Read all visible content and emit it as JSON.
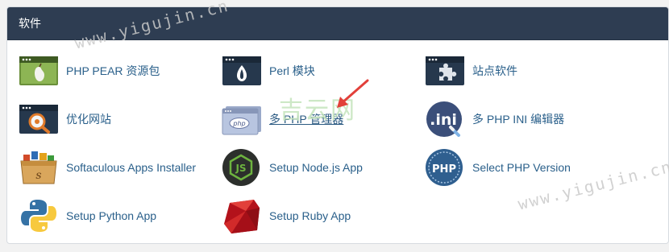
{
  "section": {
    "title": "软件"
  },
  "items": [
    {
      "label": "PHP PEAR 资源包",
      "icon": "pear-icon"
    },
    {
      "label": "Perl 模块",
      "icon": "perl-icon"
    },
    {
      "label": "站点软件",
      "icon": "puzzle-icon"
    },
    {
      "label": "优化网站",
      "icon": "optimize-icon"
    },
    {
      "label": "多 PHP 管理器",
      "icon": "php-manager-icon"
    },
    {
      "label": "多 PHP INI 编辑器",
      "icon": "ini-editor-icon"
    },
    {
      "label": "Softaculous Apps Installer",
      "icon": "softaculous-icon"
    },
    {
      "label": "Setup Node.js App",
      "icon": "nodejs-icon"
    },
    {
      "label": "Select PHP Version",
      "icon": "php-version-icon"
    },
    {
      "label": "Setup Python App",
      "icon": "python-icon"
    },
    {
      "label": "Setup Ruby App",
      "icon": "ruby-icon"
    }
  ],
  "watermarks": {
    "top": "www.yigujin.cn",
    "right": "www.yigujin.cn",
    "bottom": "www.yigujin.cn",
    "center": "吉云网"
  },
  "colors": {
    "header_bg": "#2e3d52",
    "link": "#295f8a",
    "arrow": "#e2403a"
  }
}
